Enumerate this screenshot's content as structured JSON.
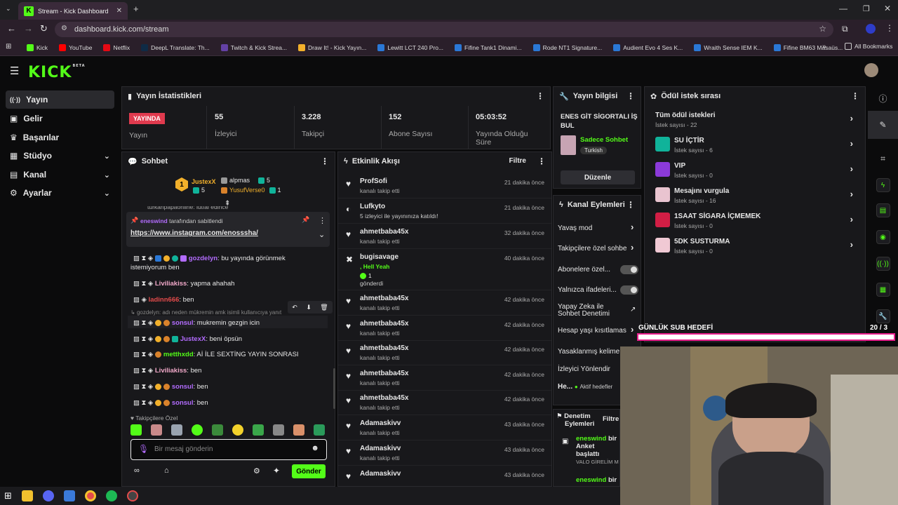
{
  "browser": {
    "tab_title": "Stream - Kick Dashboard",
    "url": "dashboard.kick.com/stream",
    "all_bookmarks": "All Bookmarks",
    "bookmarks": [
      "Kick",
      "YouTube",
      "Netflix",
      "DeepL Translate: Th...",
      "Twitch & Kick Strea...",
      "Draw It! - Kick Yayın...",
      "Lewitt LCT 240 Pro...",
      "Fifine Tank1 Dinami...",
      "Rode NT1 Signature...",
      "Audient Evo 4 Ses K...",
      "Wraith Sense IEM K...",
      "Fifine BM63 Masaüs..."
    ]
  },
  "app": {
    "logo": "KICK",
    "logo_beta": "BETA"
  },
  "sidebar": [
    {
      "label": "Yayın",
      "icon": "broadcast-icon"
    },
    {
      "label": "Gelir",
      "icon": "dollar-icon"
    },
    {
      "label": "Başarılar",
      "icon": "trophy-icon"
    },
    {
      "label": "Stüdyo",
      "icon": "studio-icon"
    },
    {
      "label": "Kanal",
      "icon": "channel-icon"
    },
    {
      "label": "Ayarlar",
      "icon": "gear-icon"
    }
  ],
  "stats": {
    "title": "Yayın İstatistikleri",
    "live_badge": "YAYINDA",
    "live_label": "Yayın",
    "items": [
      {
        "value": "55",
        "label": "İzleyici"
      },
      {
        "value": "3.228",
        "label": "Takipçi"
      },
      {
        "value": "152",
        "label": "Abone Sayısı"
      },
      {
        "value": "05:03:52",
        "label": "Yayında Olduğu Süre"
      }
    ]
  },
  "stream_info": {
    "title": "Yayın bilgisi",
    "stream_title": "ENES GİT SİGORTALI İŞ BUL",
    "category": "Sadece Sohbet",
    "tag": "Turkish",
    "edit_label": "Düzenle"
  },
  "rewards": {
    "title": "Ödül istek sırası",
    "items": [
      {
        "title": "Tüm ödül istekleri",
        "sub": "İstek sayısı - 22",
        "color": ""
      },
      {
        "title": "SU İÇTİR",
        "sub": "İstek sayısı - 6",
        "color": "#10b39a"
      },
      {
        "title": "VIP",
        "sub": "İstek sayısı - 0",
        "color": "#8b3ad9"
      },
      {
        "title": "Mesajını vurgula",
        "sub": "İstek sayısı - 16",
        "color": "#e9c4d0"
      },
      {
        "title": "1SAAT SİGARA İÇMEMEK",
        "sub": "İstek sayısı - 0",
        "color": "#d21e45"
      },
      {
        "title": "5DK SUSTURMA",
        "sub": "İstek sayısı - 0",
        "color": "#f0c9d4"
      }
    ]
  },
  "chat": {
    "title": "Sohbet",
    "leaders": [
      {
        "name": "JustexX",
        "count": "5"
      },
      {
        "name": "alpmas",
        "count": "5"
      },
      {
        "name": "YusufVerse0",
        "count": "1"
      }
    ],
    "pinned_by": "eneswind",
    "pinned_suffix": "tarafından sabitlendi",
    "pinned_link": "https://www.instagram.com/enosssha/",
    "scrolled_top": "turkanpapaonline: lütfal edince",
    "reply_hint": "gozdelyn: adı neden mükremin amk isimli kullanıcıya yanıt",
    "messages": [
      {
        "user": "gozdelyn",
        "text": ": bu yayında görünmek",
        "text2": "istemiyorum ben",
        "color": "#b36cff"
      },
      {
        "user": "Liviliakiss",
        "text": ": yapma ahahah",
        "color": "#f0a8c8"
      },
      {
        "user": "ladinn666",
        "text": ": ben",
        "color": "#e34b4b"
      },
      {
        "user": "sonsul",
        "text": ": mukremin gezgin icin",
        "color": "#b36cff"
      },
      {
        "user": "JustexX",
        "text": ": beni öpsün",
        "color": "#b36cff"
      },
      {
        "user": "metthxdd",
        "text": ": Aİ İLE SEXTİNG YAYIN SONRASI",
        "color": "#53fc18"
      },
      {
        "user": "Liviliakiss",
        "text": ": ben",
        "color": "#f0a8c8"
      },
      {
        "user": "sonsul",
        "text": ": ben",
        "color": "#b36cff"
      },
      {
        "user": "sonsul",
        "text": ": ben",
        "color": "#b36cff"
      }
    ],
    "followers_only": "Takipçilere Özel",
    "placeholder": "Bir mesaj gönderin",
    "send": "Gönder"
  },
  "activity": {
    "title": "Etkinlik Akışı",
    "filter": "Filtre",
    "items": [
      {
        "name": "ProfSofi",
        "sub": "kanalı takip etti",
        "time": "21 dakika önce"
      },
      {
        "name": "Lufkyto",
        "sub": "5 izleyici ile yayınınıza katıldı!",
        "time": "21 dakika önce"
      },
      {
        "name": "ahmetbaba45x",
        "sub": "kanalı takip etti",
        "time": "32 dakika önce"
      },
      {
        "name": "bugisavage",
        "sub": ", Hell Yeah",
        "extra": "1",
        "extra2": "gönderdi",
        "time": "40 dakika önce"
      },
      {
        "name": "ahmetbaba45x",
        "sub": "kanalı takip etti",
        "time": "42 dakika önce"
      },
      {
        "name": "ahmetbaba45x",
        "sub": "kanalı takip etti",
        "time": "42 dakika önce"
      },
      {
        "name": "ahmetbaba45x",
        "sub": "kanalı takip etti",
        "time": "42 dakika önce"
      },
      {
        "name": "ahmetbaba45x",
        "sub": "kanalı takip etti",
        "time": "42 dakika önce"
      },
      {
        "name": "ahmetbaba45x",
        "sub": "kanalı takip etti",
        "time": "42 dakika önce"
      },
      {
        "name": "Adamaskivv",
        "sub": "kanalı takip etti",
        "time": "43 dakika önce"
      },
      {
        "name": "Adamaskivv",
        "sub": "kanalı takip etti",
        "time": "43 dakika önce"
      },
      {
        "name": "Adamaskivv",
        "sub": "",
        "time": "43 dakika önce"
      }
    ]
  },
  "channel_actions": {
    "title": "Kanal Eylemleri",
    "items": [
      "Yavaş mod",
      "Takipçilere özel sohbe",
      "Abonelere özel...",
      "Yalnızca ifadeleri...",
      "Yapay Zeka ile",
      "Sohbet Denetimi",
      "Hesap yaşı kısıtlamas",
      "Yasaklanmış kelime",
      "İzleyici Yönlendir",
      "He..."
    ],
    "active_hosts": "Aktif hedefler"
  },
  "moderation": {
    "title1": "Denetim",
    "title2": "Eylemleri",
    "filter": "Filtre",
    "entry_user": "eneswind",
    "entry_tail": "bir",
    "entry_l2": "Anket",
    "entry_l3": "başlattı",
    "entry_l4": "VALO GİRELİM M",
    "entry2_user": "eneswind",
    "entry2_tail": "bir"
  },
  "goal": {
    "title": "GÜNLÜK SUB HEDEFİ",
    "progress": "20 / 3",
    "fraction": 1.0
  }
}
